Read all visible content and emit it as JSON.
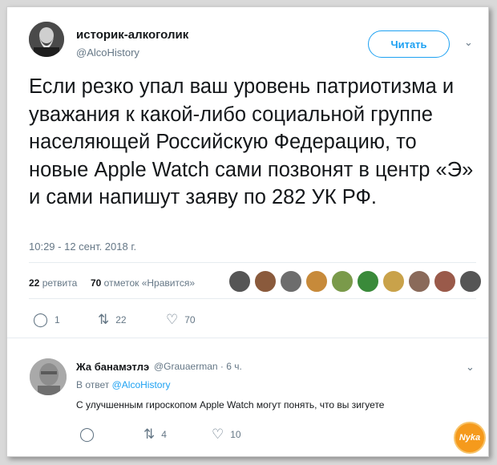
{
  "tweet": {
    "author_name": "историк-алкоголик",
    "author_handle": "@AlcoHistory",
    "follow_label": "Читать",
    "text": "Если резко упал ваш уровень патриотизма и уважания к какой-либо социальной группе населяющей Российскую Федерацию, то новые Apple Watch сами позвонят в центр «Э» и сами напишут заяву по 282 УК РФ.",
    "timestamp": "10:29 - 12 сент. 2018 г.",
    "retweets_count": "22",
    "retweets_label": "ретвита",
    "likes_count": "70",
    "likes_label": "отметок «Нравится»",
    "liker_colors": [
      "#555555",
      "#8a5a3c",
      "#6d6d6d",
      "#c78a3a",
      "#7a9a4a",
      "#3a8a3a",
      "#c9a24a",
      "#8a6a5a",
      "#9a5a4a",
      "#555555"
    ],
    "actions": {
      "reply": "1",
      "retweet": "22",
      "like": "70"
    }
  },
  "reply": {
    "author_name": "Жа банамэтлэ",
    "author_handle": "@Grauaerman · 6 ч.",
    "reply_to_prefix": "В ответ",
    "reply_to_handle": "@AlcoHistory",
    "text": "С улучшенным гироскопом Apple Watch могут понять, что вы зигуете",
    "actions": {
      "retweet": "4",
      "like": "10"
    }
  },
  "watermark": {
    "text": "Nyka"
  },
  "colors": {
    "accent": "#1da1f2",
    "muted": "#657786",
    "text": "#14171a"
  }
}
